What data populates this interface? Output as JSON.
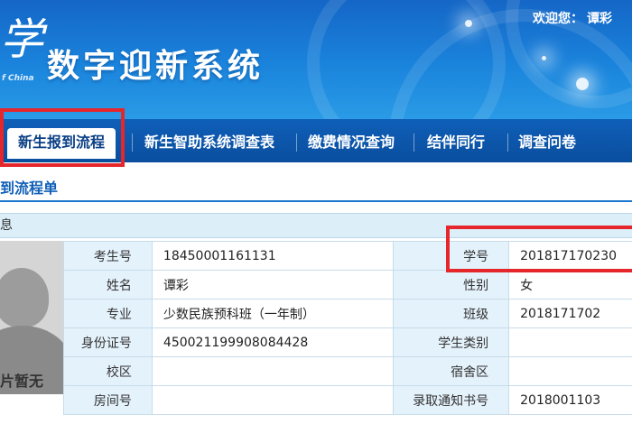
{
  "banner": {
    "logo_glyph": "学",
    "logo_sub": "f China",
    "site_title": "数字迎新系统",
    "welcome_label": "欢迎您：",
    "username": "谭彩"
  },
  "tabs": [
    {
      "label": "新生报到流程",
      "active": true
    },
    {
      "label": "新生智助系统调查表"
    },
    {
      "label": "缴费情况查询"
    },
    {
      "label": "结伴同行"
    },
    {
      "label": "调查问卷"
    }
  ],
  "section": {
    "title": "到流程单",
    "subhead": "息"
  },
  "photo": {
    "label": "片暂无"
  },
  "info": {
    "rows": [
      {
        "l1": "考生号",
        "v1": "18450001161131",
        "l2": "学号",
        "v2": "201817170230"
      },
      {
        "l1": "姓名",
        "v1": "谭彩",
        "l2": "性别",
        "v2": "女"
      },
      {
        "l1": "专业",
        "v1": "少数民族预科班（一年制）",
        "l2": "班级",
        "v2": "2018171702"
      },
      {
        "l1": "身份证号",
        "v1": "450021199908084428",
        "l2": "学生类别",
        "v2": ""
      },
      {
        "l1": "校区",
        "v1": "",
        "l2": "宿舍区",
        "v2": ""
      },
      {
        "l1": "房间号",
        "v1": "",
        "l2": "录取通知书号",
        "v2": "2018001103"
      }
    ]
  },
  "colors": {
    "banner_top": "#1566c6",
    "tabbar": "#0a4e9e",
    "label_cell": "#e4f2fb",
    "highlight": "#e5262b",
    "section_title": "#1060b8"
  }
}
